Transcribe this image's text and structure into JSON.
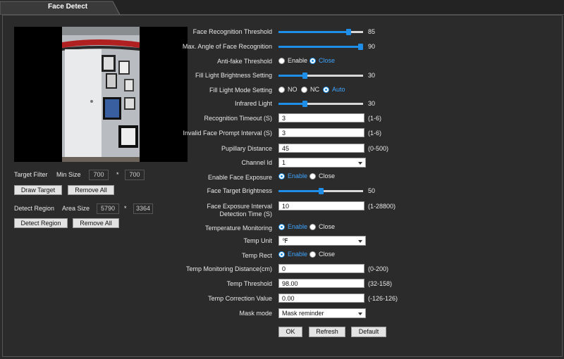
{
  "tab": {
    "title": "Face Detect"
  },
  "colors": {
    "accent": "#1e8ee9",
    "background": "#2b2b2b"
  },
  "left": {
    "target_filter": "Target Filter",
    "min_size": "Min Size",
    "min_w": "700",
    "times1": "*",
    "min_h": "700",
    "draw_target": "Draw Target",
    "remove_all_1": "Remove All",
    "detect_region": "Detect Region",
    "area_size": "Area Size",
    "area_w": "5790",
    "times2": "*",
    "area_h": "3364",
    "detect_region_btn": "Detect Region",
    "remove_all_2": "Remove All"
  },
  "fields": {
    "face_recognition_threshold": {
      "label": "Face Recognition Threshold",
      "value": "85",
      "fraction": 0.85
    },
    "max_angle": {
      "label": "Max. Angle of Face Recognition",
      "value": "90",
      "fraction": 1.0
    },
    "anti_fake": {
      "label": "Anti-fake Threshold",
      "opt1": "Enable",
      "opt2": "Close",
      "selected": "Close"
    },
    "fill_light_brightness": {
      "label": "Fill Light Brightness Setting",
      "value": "30",
      "fraction": 0.3
    },
    "fill_light_mode": {
      "label": "Fill Light Mode Setting",
      "opt1": "NO",
      "opt2": "NC",
      "opt3": "Auto",
      "selected": "Auto"
    },
    "infrared_light": {
      "label": "Infrared Light",
      "value": "30",
      "fraction": 0.3
    },
    "recognition_timeout": {
      "label": "Recognition Timeout (S)",
      "value": "3",
      "range": "(1-6)"
    },
    "invalid_face_prompt": {
      "label": "Invalid Face Prompt Interval (S)",
      "value": "3",
      "range": "(1-6)"
    },
    "pupillary_distance": {
      "label": "Pupillary Distance",
      "value": "45",
      "range": "(0-500)"
    },
    "channel_id": {
      "label": "Channel Id",
      "value": "1"
    },
    "enable_face_exposure": {
      "label": "Enable Face Exposure",
      "opt1": "Enable",
      "opt2": "Close",
      "selected": "Enable"
    },
    "face_target_brightness": {
      "label": "Face Target Brightness",
      "value": "50",
      "fraction": 0.5
    },
    "face_exposure_interval": {
      "label1": "Face Exposure Interval",
      "label2": "Detection Time (S)",
      "value": "10",
      "range": "(1-28800)"
    },
    "temperature_monitoring": {
      "label": "Temperature Monitoring",
      "opt1": "Enable",
      "opt2": "Close",
      "selected": "Enable"
    },
    "temp_unit": {
      "label": "Temp Unit",
      "value": "℉"
    },
    "temp_rect": {
      "label": "Temp Rect",
      "opt1": "Enable",
      "opt2": "Close",
      "selected": "Enable"
    },
    "temp_monitoring_distance": {
      "label": "Temp Monitoring Distance(cm)",
      "value": "0",
      "range": "(0-200)"
    },
    "temp_threshold": {
      "label": "Temp Threshold",
      "value": "98.00",
      "range": "(32-158)"
    },
    "temp_correction": {
      "label": "Temp Correction Value",
      "value": "0.00",
      "range": "(-126-126)"
    },
    "mask_mode": {
      "label": "Mask mode",
      "value": "Mask reminder"
    }
  },
  "actions": {
    "ok": "OK",
    "refresh": "Refresh",
    "default": "Default"
  }
}
